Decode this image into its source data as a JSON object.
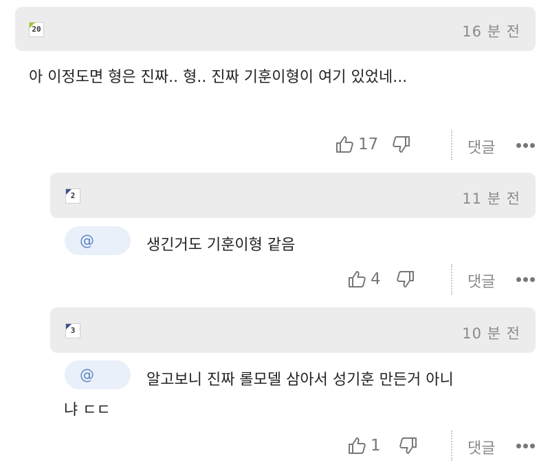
{
  "comments": [
    {
      "level": "20",
      "time": "16 분 전",
      "text": "아 이정도면 형은 진짜.. 형.. 진짜 기훈이형이 여기 있었네...",
      "likes": "17",
      "reply_label": "댓글"
    },
    {
      "level": "2",
      "time": "11 분 전",
      "mention": "@",
      "text": "생긴거도 기훈이형 같음",
      "likes": "4",
      "reply_label": "댓글"
    },
    {
      "level": "3",
      "time": "10 분 전",
      "mention": "@",
      "text_line1": "알고보니 진짜 롤모델 삼아서 성기훈 만든거 아니",
      "text_line2": "냐 ㄷㄷ",
      "likes": "1",
      "reply_label": "댓글"
    }
  ],
  "icons": {
    "like": "thumbs-up-icon",
    "dislike": "thumbs-down-icon",
    "more": "more-dots-icon"
  },
  "colors": {
    "header_bg": "#ececec",
    "mention_bg": "#e9f0fa",
    "mention_text": "#5b84c4",
    "level_green": "#9ccc2e",
    "level_navy": "#3f4f8f"
  }
}
